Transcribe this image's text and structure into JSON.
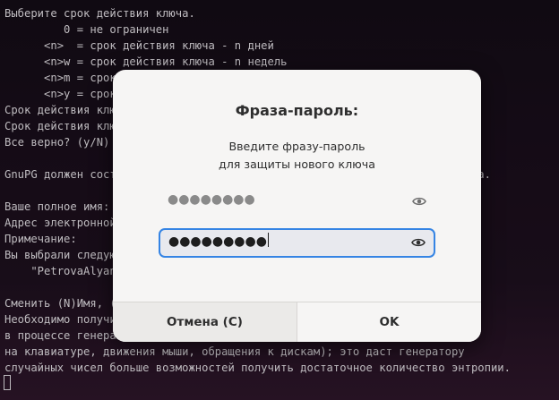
{
  "terminal": {
    "lines": [
      "Выберите срок действия ключа.",
      "         0 = не ограничен",
      "      <n>  = срок действия ключа - n дней",
      "      <n>w = срок действия ключа - n недель",
      "      <n>m = срок действия ключа - n месяцев",
      "      <n>y = срок действия ключа - n лет",
      "Срок действия ключа? (0) 0",
      "Срок действия ключа не ограничен",
      "Все верно? (y/N) y",
      "",
      "GnuPG должен составить идентификатор пользователя для идентификации ключа.",
      "",
      "Ваше полное имя: PetrovaAlyana",
      "Адрес электронной почты:",
      "Примечание:",
      "Вы выбрали следующий идентификатор пользователя:",
      "    \"PetrovaAlyana\"",
      "",
      "Сменить (N)Имя, (C)Примечание, (E)Адрес; (O)Принять/(Q)Выход? O",
      "Необходимо получить много случайных чисел. Желательно, чтобы Вы",
      "в процессе генерации выполняли какие-то другие действия (печать",
      "на клавиатуре, движения мыши, обращения к дискам); это даст генератору",
      "случайных чисел больше возможностей получить достаточное количество энтропии."
    ]
  },
  "dialog": {
    "title": "Фраза-пароль:",
    "description_line1": "Введите фразу-пароль",
    "description_line2": "для защиты нового ключа",
    "passphrase_field": {
      "value": "●●●●●●●●",
      "icon": "eye-icon"
    },
    "repeat_field": {
      "value": "●●●●●●●●●",
      "icon": "eye-icon",
      "focused": true
    },
    "cancel_label": "Отмена (C)",
    "ok_label": "OK"
  },
  "colors": {
    "accent": "#3584e4",
    "dialog_bg": "#f6f5f4",
    "terminal_bg": "#170c18",
    "terminal_text": "#cfcbd0"
  }
}
